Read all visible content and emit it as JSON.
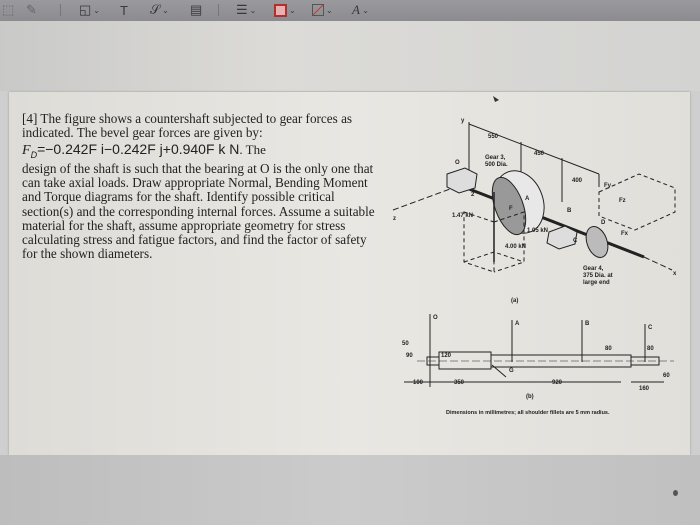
{
  "toolbar": {
    "items": [
      "select-tool",
      "draw-tool",
      "shapes-tool",
      "text-tool",
      "sign-tool",
      "note-tool",
      "line-style",
      "border-color",
      "fill-color",
      "text-style"
    ],
    "text_tool_label": "T",
    "text_style_label": "A",
    "border_color": "#b03030"
  },
  "problem": {
    "intro": "[4] The figure shows a countershaft subjected to gear forces as indicated. The bevel gear forces are given by:",
    "equation": {
      "lhs": "F",
      "lhs_sub": "D",
      "rhs": "=−0.242F i−0.242F j+0.940F k N",
      "tail": ". The"
    },
    "body": "design of the shaft is such that the bearing at O is the only one that can take axial loads. Draw appropriate Normal, Bending Moment and Torque diagrams for the shaft. Identify possible critical section(s) and the corresponding internal forces. Assume a suitable material for the shaft, assume appropriate geometry for stress calculating stress and fatigue factors, and find the factor of safety for the shown diameters."
  },
  "figure_a": {
    "axis_y": "y",
    "axis_z": "z",
    "axis_x": "x",
    "dim_550": "550",
    "dim_450": "450",
    "dim_400": "400",
    "gear3": "Gear 3,",
    "gear3_dia": "500 Dia.",
    "label_o": "O",
    "label_a": "A",
    "label_b": "B",
    "label_c": "C",
    "label_d": "D",
    "label_f": "F",
    "label_2": "2",
    "force_147": "1.47 kN",
    "force_105": "1.05 kN",
    "force_400": "4.00 kN",
    "fy": "Fy",
    "fz": "Fz",
    "fx": "Fx",
    "gear4": "Gear 4,",
    "gear4_dia": "375 Dia. at",
    "gear4_end": "large end",
    "caption": "(a)"
  },
  "figure_b": {
    "label_o": "O",
    "label_a": "A",
    "label_b": "B",
    "label_c": "C",
    "label_g": "G",
    "d50": "50",
    "d90": "90",
    "d120": "120",
    "d80a": "80",
    "d80b": "80",
    "d60": "60",
    "l100": "100",
    "l350": "350",
    "l920": "920",
    "l160": "160",
    "caption": "(b)",
    "note": "Dimensions in millimetres; all shoulder fillets are 5 mm radius."
  }
}
